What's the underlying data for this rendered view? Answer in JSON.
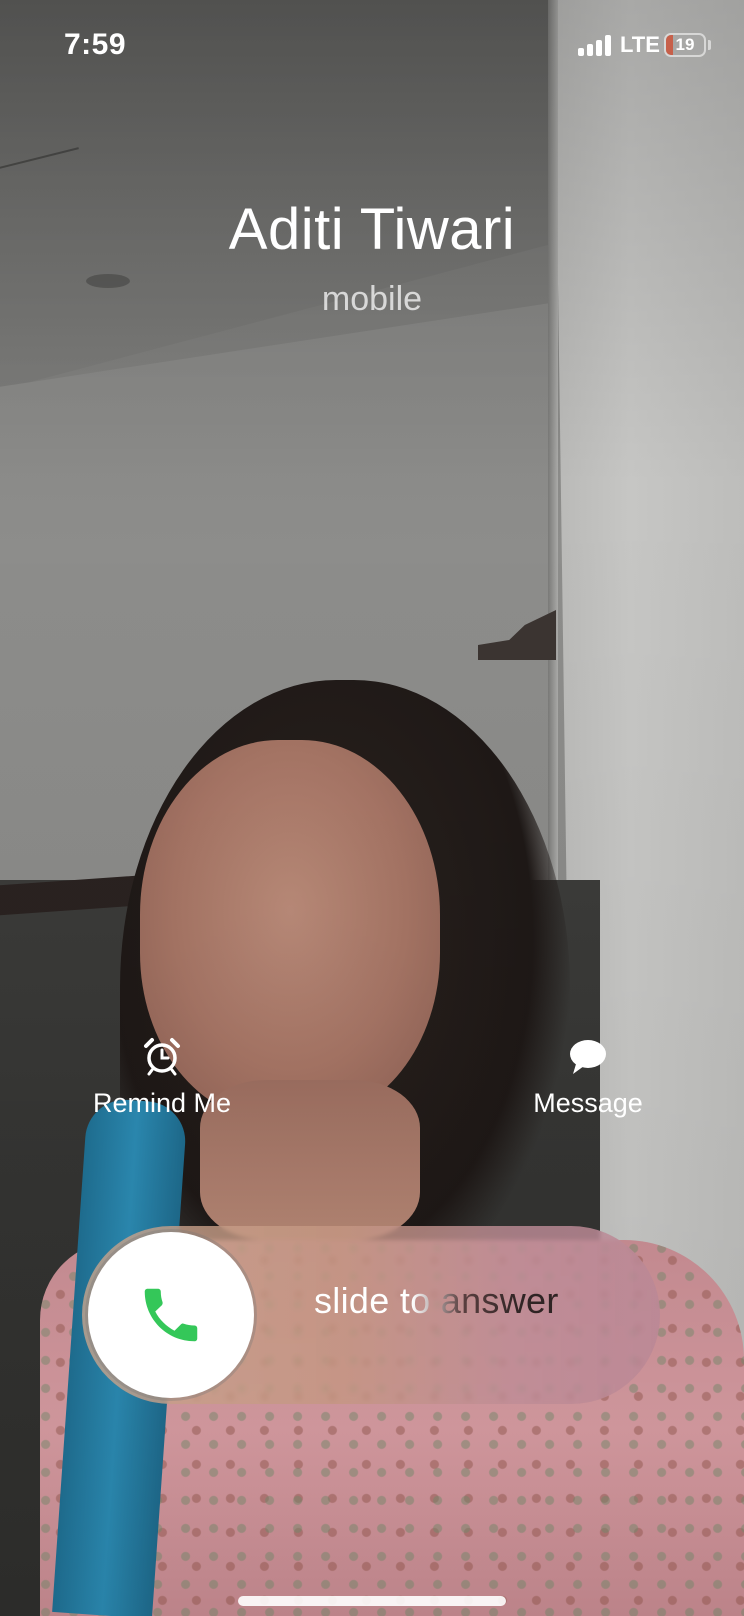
{
  "status_bar": {
    "time": "7:59",
    "carrier": "LTE",
    "battery_level": "19",
    "battery_percent": 19,
    "signal_bars": 4
  },
  "caller": {
    "name": "Aditi Tiwari",
    "label": "mobile"
  },
  "actions": {
    "remind": {
      "label": "Remind Me",
      "icon": "alarm-clock-icon"
    },
    "message": {
      "label": "Message",
      "icon": "message-bubble-icon"
    }
  },
  "slider": {
    "text": "slide to answer",
    "icon": "phone-icon",
    "accent": "#34c759"
  }
}
